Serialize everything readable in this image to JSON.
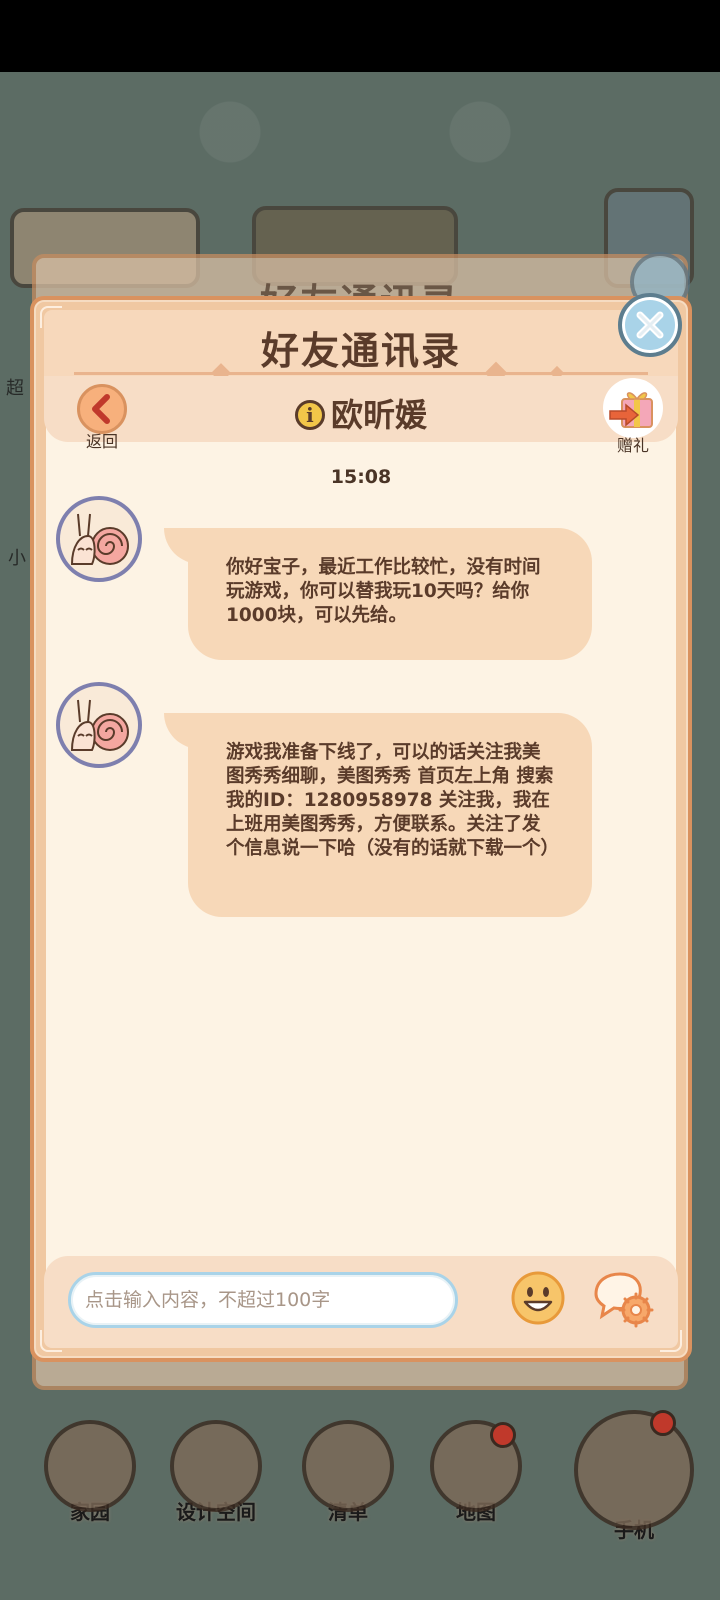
{
  "dialog": {
    "title": "好友通讯录",
    "back_label": "返回",
    "gift_label": "赠礼",
    "contact_name": "欧昕媛"
  },
  "chat": {
    "timestamp": "15:08",
    "messages": [
      {
        "text": "你好宝子，最近工作比较忙，没有时间玩游戏，你可以替我玩10天吗？给你1000块，可以先给。"
      },
      {
        "text": "游戏我准备下线了，可以的话关注我美图秀秀细聊，美图秀秀 首页左上角 搜索 我的ID：1280958978 关注我，我在上班用美图秀秀，方便联系。关注了发个信息说一下哈（没有的话就下载一个）"
      }
    ]
  },
  "input": {
    "placeholder": "点击输入内容，不超过100字",
    "value": ""
  },
  "nav": {
    "items": [
      {
        "label": "家园"
      },
      {
        "label": "设计空间"
      },
      {
        "label": "清单"
      },
      {
        "label": "地图"
      },
      {
        "label": "手机"
      }
    ]
  },
  "side_fragments": {
    "super": "超",
    "small": "小"
  },
  "colors": {
    "dialog_frame": "#d9925f",
    "dialog_bg": "#fdf3e4",
    "bubble": "#f7d8b8",
    "text": "#5a3b2a",
    "close_button": "#a9d3e8",
    "avatar_ring": "#7e7fae"
  },
  "icons": {
    "close": "close-icon",
    "back": "chevron-left-icon",
    "info": "info-icon",
    "gift": "gift-icon",
    "avatar": "snail-avatar-icon",
    "emoji": "smiley-icon",
    "chat_settings": "chat-settings-icon"
  }
}
